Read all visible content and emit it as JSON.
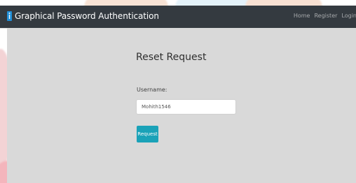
{
  "header": {
    "brand": "Graphical Password Authentication",
    "nav": [
      "Home",
      "Register",
      "Login"
    ]
  },
  "form": {
    "title": "Reset Request",
    "username_label": "Username:",
    "username_value": "Mohith1546",
    "button_label": "Request"
  },
  "colors": {
    "navbar": "#343a40",
    "page_panel": "#d9d9d9",
    "button": "#1aa2b8"
  },
  "icons": {
    "brand": "info-icon"
  }
}
